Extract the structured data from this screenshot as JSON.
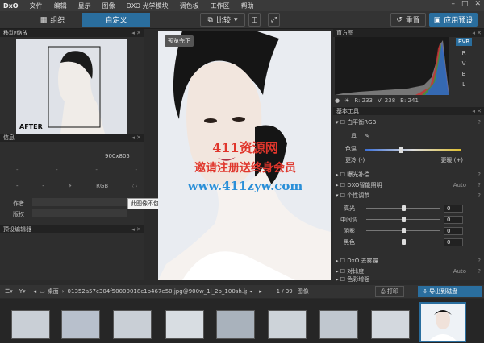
{
  "menu": {
    "logo": "DxO",
    "items": [
      "文件",
      "编辑",
      "显示",
      "图像",
      "DXO 光学模块",
      "调色板",
      "工作区",
      "帮助"
    ]
  },
  "toolbar": {
    "organize": "组织",
    "customize": "自定义",
    "compare": "比较",
    "reset": "重置",
    "apply_preset": "应用预设"
  },
  "left": {
    "move_zoom": "移动/缩放",
    "after": "AFTER",
    "info": "信息",
    "dimensions": "900x805",
    "color_mode": "RGB",
    "author": "作者",
    "copyright": "版权",
    "tooltip": "此图像不包含任何捐赠信息",
    "preset_editor": "预设编辑器"
  },
  "center": {
    "tag": "预览完正"
  },
  "watermark": {
    "line1": "411资源网",
    "line2": "邀请注册送终身会员",
    "line3": "www.411zyw.com"
  },
  "histogram": {
    "title": "直方图",
    "channels": [
      "RVB",
      "R",
      "V",
      "B",
      "L"
    ],
    "active_channel": "RVB",
    "r": "R: 233",
    "v": "V: 238",
    "b": "B: 241"
  },
  "tools": {
    "title": "基本工具",
    "white_balance": "白平衡RGB",
    "tool_label": "工具",
    "color_label": "色温",
    "cooler": "更冷 (-)",
    "warmer": "更暖 (+)",
    "exposure": "曝光补偿",
    "smart_lighting": "DXO智能照明",
    "smart_value": "Auto",
    "tone": "个性调节",
    "sliders": [
      {
        "label": "高光",
        "value": "0"
      },
      {
        "label": "中间调",
        "value": "0"
      },
      {
        "label": "阴影",
        "value": "0"
      },
      {
        "label": "黑色",
        "value": "0"
      }
    ],
    "denoise": "DxO 去雾霾",
    "contrast": "对比度",
    "contrast_value": "Auto",
    "color_boost": "色彩增强"
  },
  "bottombar": {
    "path_label": "桌面",
    "filename": "01352a57c304f50000018c1b467e50.jpg@900w_1l_2o_100sh.jpg",
    "page": "1 / 39",
    "image_label": "图像",
    "print": "打印",
    "export": "导出到磁盘"
  },
  "colors": {
    "accent": "#2a6e9e",
    "watermark_red": "#e0362c",
    "watermark_blue": "#2a8fd8"
  }
}
